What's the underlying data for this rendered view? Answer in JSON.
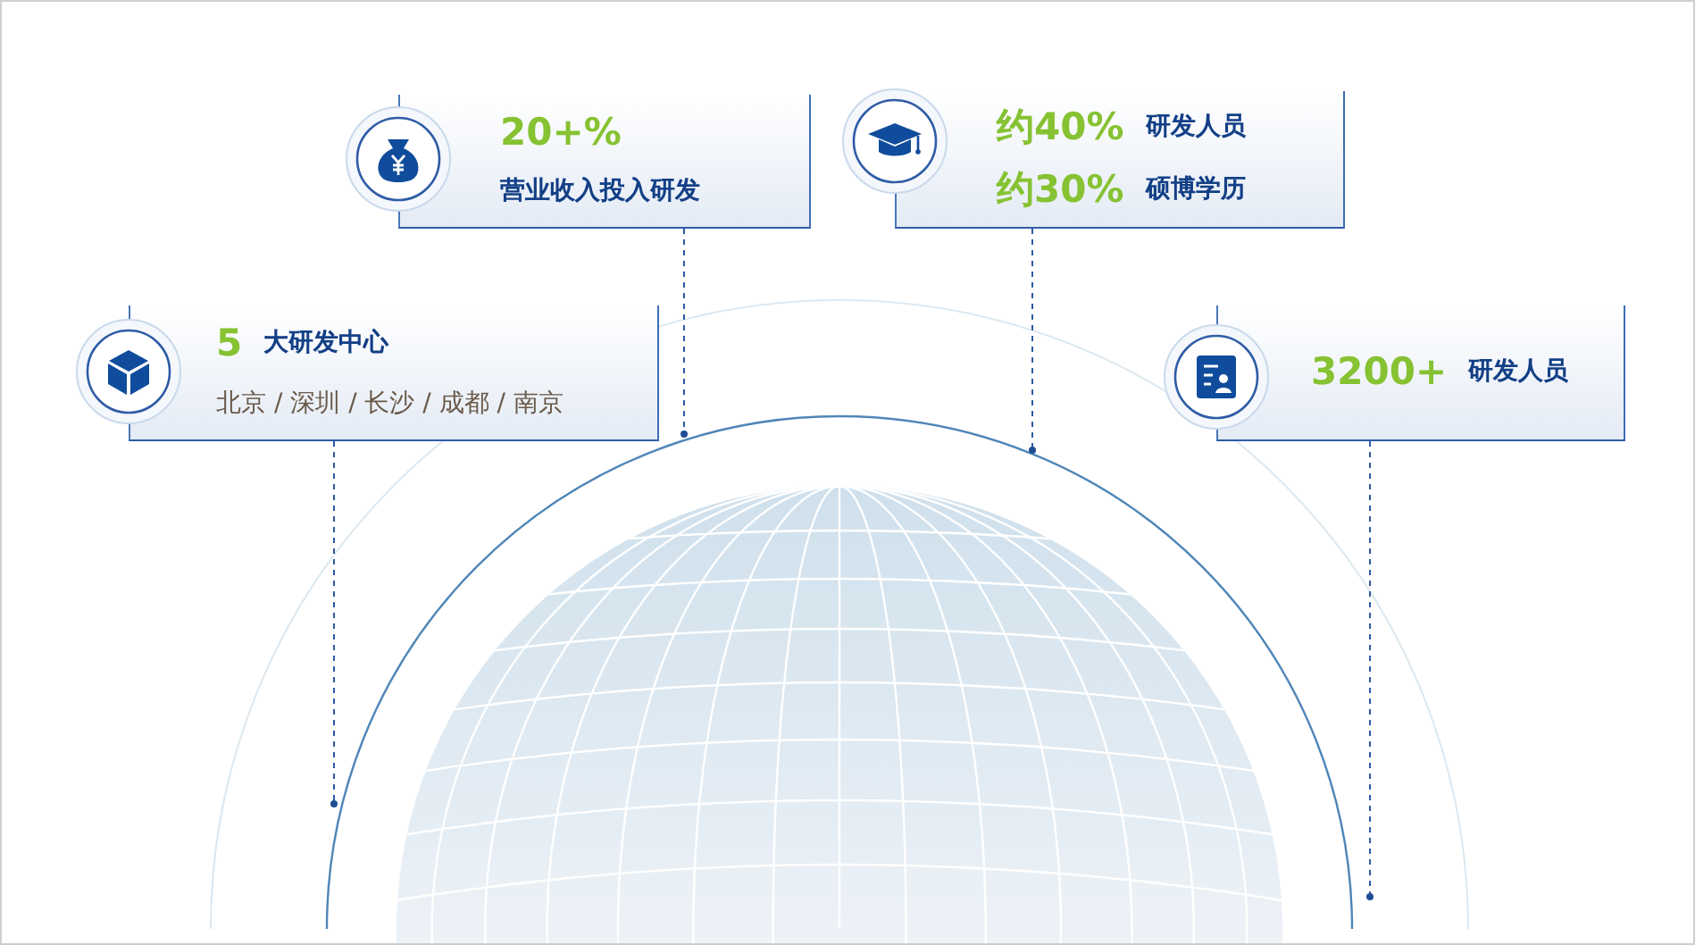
{
  "cards": [
    {
      "kind": "money",
      "lines": [
        {
          "kind": "value",
          "text": "20+%"
        },
        {
          "kind": "label",
          "text": "营业收入投入研发"
        }
      ]
    },
    {
      "kind": "cap",
      "lines": [
        {
          "kind": "pair",
          "value": "约40%",
          "label": "研发人员"
        },
        {
          "kind": "pair",
          "value": "约30%",
          "label": "硕博学历"
        }
      ]
    },
    {
      "kind": "cube",
      "lines": [
        {
          "kind": "pair",
          "value": "5",
          "label": "大研发中心"
        },
        {
          "kind": "caption",
          "text": "北京 / 深圳 / 长沙 / 成都 / 南京"
        }
      ]
    },
    {
      "kind": "person",
      "lines": [
        {
          "kind": "pair",
          "value": "3200+",
          "label": "研发人员"
        }
      ]
    }
  ]
}
